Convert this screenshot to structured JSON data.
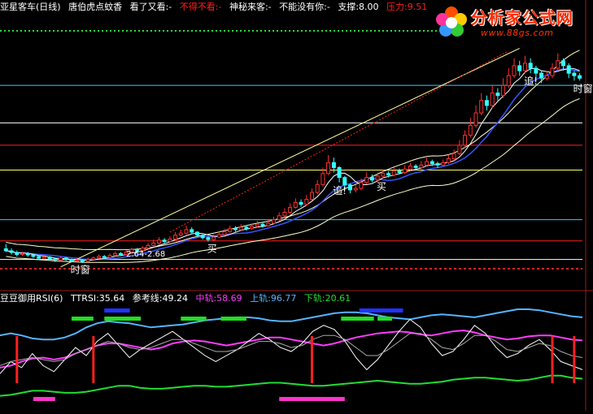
{
  "main_header": {
    "title": "亚星客车(日线)",
    "indicator": "唐伯虎点蚊香",
    "items": [
      {
        "label": "看了又看:-",
        "color": "#ffffff"
      },
      {
        "label": "不得不看:-",
        "color": "#ff2020"
      },
      {
        "label": "神秘来客:-",
        "color": "#ffffff"
      },
      {
        "label": "不能没有你:-",
        "color": "#ffffff"
      },
      {
        "label": "支撑:8.00",
        "color": "#ffffff"
      },
      {
        "label": "压力:9.51",
        "color": "#ff2020"
      }
    ]
  },
  "sub_header": {
    "title": "豆豆御用RSI(6)",
    "items": [
      {
        "label": "TTRSI:35.64",
        "color": "#ffffff"
      },
      {
        "label": "参考线:49.24",
        "color": "#ffffff"
      },
      {
        "label": "中轨:58.69",
        "color": "#ff3cff"
      },
      {
        "label": "上轨:96.77",
        "color": "#55b4ff"
      },
      {
        "label": "下轨:20.61",
        "color": "#22dd33"
      }
    ]
  },
  "logo": {
    "name": "分析家公式网",
    "url": "www.88gs.com"
  },
  "chart_data": [
    {
      "type": "candlestick",
      "panel": "main",
      "description_labels": {
        "annotations": [
          {
            "text": "时窗",
            "x": 14,
            "color": "#ffffff"
          },
          {
            "text": "时窗",
            "x": 112,
            "color": "#ffffff"
          },
          {
            "text": "追!",
            "x": 62,
            "color": "#ffffff"
          },
          {
            "text": "追!",
            "x": 97,
            "color": "#ffffff"
          },
          {
            "text": "买",
            "x": 39,
            "color": "#ffffff"
          },
          {
            "text": "买",
            "x": 70,
            "color": "#ffffff"
          }
        ],
        "value_label": "2.64-2.68"
      },
      "ylim": [
        1.9,
        11.05
      ],
      "bars": [
        [
          2.93,
          2.85,
          3.12,
          2.8
        ],
        [
          2.85,
          2.78,
          2.95,
          2.7
        ],
        [
          2.78,
          2.7,
          2.86,
          2.62
        ],
        [
          2.7,
          2.74,
          2.82,
          2.64
        ],
        [
          2.74,
          2.68,
          2.8,
          2.6
        ],
        [
          2.68,
          2.62,
          2.74,
          2.56
        ],
        [
          2.62,
          2.55,
          2.66,
          2.48
        ],
        [
          2.55,
          2.6,
          2.66,
          2.5
        ],
        [
          2.6,
          2.52,
          2.64,
          2.46
        ],
        [
          2.52,
          2.48,
          2.58,
          2.4
        ],
        [
          2.48,
          2.56,
          2.62,
          2.44
        ],
        [
          2.56,
          2.5,
          2.6,
          2.45
        ],
        [
          2.5,
          2.44,
          2.54,
          2.38
        ],
        [
          2.44,
          2.48,
          2.58,
          2.4
        ],
        [
          2.48,
          2.42,
          2.52,
          2.36
        ],
        [
          2.42,
          2.5,
          2.58,
          2.38
        ],
        [
          2.5,
          2.56,
          2.62,
          2.46
        ],
        [
          2.56,
          2.62,
          2.7,
          2.52
        ],
        [
          2.62,
          2.58,
          2.68,
          2.52
        ],
        [
          2.58,
          2.66,
          2.74,
          2.54
        ],
        [
          2.66,
          2.74,
          2.82,
          2.62
        ],
        [
          2.74,
          2.7,
          2.8,
          2.64
        ],
        [
          2.7,
          2.8,
          2.88,
          2.66
        ],
        [
          2.8,
          2.9,
          2.98,
          2.76
        ],
        [
          2.9,
          2.86,
          2.96,
          2.8
        ],
        [
          2.86,
          2.96,
          3.04,
          2.82
        ],
        [
          2.96,
          3.06,
          3.16,
          2.92
        ],
        [
          3.06,
          3.16,
          3.3,
          3.02
        ],
        [
          3.16,
          3.28,
          3.4,
          3.1
        ],
        [
          3.28,
          3.22,
          3.36,
          3.14
        ],
        [
          3.22,
          3.32,
          3.44,
          3.18
        ],
        [
          3.32,
          3.48,
          3.6,
          3.28
        ],
        [
          3.48,
          3.56,
          3.7,
          3.42
        ],
        [
          3.56,
          3.7,
          3.86,
          3.5
        ],
        [
          3.7,
          3.6,
          3.8,
          3.52
        ],
        [
          3.6,
          3.48,
          3.64,
          3.4
        ],
        [
          3.48,
          3.38,
          3.52,
          3.3
        ],
        [
          3.38,
          3.3,
          3.44,
          3.22
        ],
        [
          3.3,
          3.4,
          3.5,
          3.26
        ],
        [
          3.4,
          3.5,
          3.62,
          3.36
        ],
        [
          3.5,
          3.62,
          3.74,
          3.46
        ],
        [
          3.62,
          3.74,
          3.86,
          3.58
        ],
        [
          3.74,
          3.7,
          3.84,
          3.62
        ],
        [
          3.7,
          3.8,
          3.92,
          3.66
        ],
        [
          3.8,
          3.74,
          3.88,
          3.66
        ],
        [
          3.74,
          3.84,
          3.96,
          3.7
        ],
        [
          3.84,
          3.92,
          4.06,
          3.78
        ],
        [
          3.92,
          3.86,
          4.0,
          3.78
        ],
        [
          3.86,
          3.96,
          4.1,
          3.82
        ],
        [
          3.96,
          4.1,
          4.22,
          3.9
        ],
        [
          4.1,
          4.26,
          4.4,
          4.04
        ],
        [
          4.26,
          4.4,
          4.56,
          4.2
        ],
        [
          4.4,
          4.6,
          4.76,
          4.34
        ],
        [
          4.6,
          4.8,
          4.96,
          4.54
        ],
        [
          4.8,
          4.72,
          4.92,
          4.62
        ],
        [
          4.72,
          4.92,
          5.1,
          4.66
        ],
        [
          4.92,
          5.2,
          5.36,
          4.86
        ],
        [
          5.2,
          5.52,
          5.7,
          5.12
        ],
        [
          5.52,
          5.96,
          6.2,
          5.44
        ],
        [
          5.96,
          6.4,
          6.7,
          5.9
        ],
        [
          6.4,
          6.2,
          6.6,
          6.0
        ],
        [
          6.2,
          5.8,
          6.26,
          5.6
        ],
        [
          5.8,
          5.5,
          5.86,
          5.3
        ],
        [
          5.5,
          5.3,
          5.56,
          5.16
        ],
        [
          5.3,
          5.36,
          5.5,
          5.2
        ],
        [
          5.36,
          5.6,
          5.76,
          5.28
        ],
        [
          5.6,
          5.8,
          6.0,
          5.52
        ],
        [
          5.8,
          5.7,
          5.92,
          5.6
        ],
        [
          5.7,
          5.86,
          6.0,
          5.6
        ],
        [
          5.86,
          5.96,
          6.1,
          5.76
        ],
        [
          5.96,
          5.9,
          6.06,
          5.8
        ],
        [
          5.9,
          6.06,
          6.2,
          5.84
        ],
        [
          6.06,
          6.0,
          6.16,
          5.92
        ],
        [
          6.0,
          6.14,
          6.3,
          5.94
        ],
        [
          6.14,
          6.26,
          6.4,
          6.06
        ],
        [
          6.26,
          6.2,
          6.34,
          6.1
        ],
        [
          6.2,
          6.3,
          6.46,
          6.14
        ],
        [
          6.3,
          6.44,
          6.6,
          6.24
        ],
        [
          6.44,
          6.36,
          6.52,
          6.26
        ],
        [
          6.36,
          6.3,
          6.44,
          6.18
        ],
        [
          6.3,
          6.4,
          6.52,
          6.24
        ],
        [
          6.4,
          6.56,
          6.72,
          6.34
        ],
        [
          6.56,
          6.76,
          6.92,
          6.48
        ],
        [
          6.76,
          7.1,
          7.3,
          6.7
        ],
        [
          7.1,
          7.5,
          7.7,
          7.0
        ],
        [
          7.5,
          7.9,
          8.2,
          7.4
        ],
        [
          7.9,
          8.4,
          8.7,
          7.8
        ],
        [
          8.4,
          8.9,
          9.2,
          8.3
        ],
        [
          8.9,
          8.7,
          9.1,
          8.5
        ],
        [
          8.7,
          9.2,
          9.5,
          8.6
        ],
        [
          9.2,
          9.1,
          9.4,
          8.9
        ],
        [
          9.1,
          9.5,
          9.8,
          9.0
        ],
        [
          9.5,
          9.9,
          10.2,
          9.4
        ],
        [
          9.9,
          10.3,
          10.6,
          9.8
        ],
        [
          10.3,
          10.1,
          10.5,
          9.9
        ],
        [
          10.1,
          10.4,
          10.7,
          10.0
        ],
        [
          10.4,
          10.2,
          10.6,
          10.0
        ],
        [
          10.2,
          10.0,
          10.3,
          9.8
        ],
        [
          10.0,
          9.8,
          10.1,
          9.6
        ],
        [
          9.8,
          9.9,
          10.1,
          9.7
        ],
        [
          9.9,
          10.2,
          10.4,
          9.8
        ],
        [
          10.2,
          10.5,
          10.8,
          10.1
        ],
        [
          10.5,
          10.3,
          10.6,
          10.1
        ],
        [
          10.3,
          10.0,
          10.4,
          9.8
        ],
        [
          10.0,
          9.9,
          10.1,
          9.7
        ],
        [
          9.9,
          9.8,
          10.0,
          9.7
        ]
      ],
      "hlines": [
        {
          "y": 9.51,
          "color": "#33ccff"
        },
        {
          "y": 8.0,
          "color": "#ffffff"
        },
        {
          "y": 7.1,
          "color": "#ff2020"
        },
        {
          "y": 6.1,
          "color": "#ffff66"
        },
        {
          "y": 4.1,
          "color": "#33ccff"
        },
        {
          "y": 3.25,
          "color": "#ff2020"
        },
        {
          "y": 2.5,
          "color": "#ffffff"
        }
      ]
    },
    {
      "type": "line",
      "panel": "sub",
      "title": "豆豆御用RSI(6)",
      "ylim": [
        0,
        100
      ],
      "series": [
        {
          "name": "上轨",
          "color": "#55b4ff",
          "values": [
            70,
            72,
            70,
            67,
            66,
            66,
            68,
            72,
            78,
            82,
            84,
            83,
            82,
            80,
            78,
            79,
            80,
            81,
            83,
            85,
            86,
            87,
            88,
            88,
            87,
            85,
            84,
            84,
            86,
            88,
            90,
            92,
            93,
            93,
            92,
            90,
            88,
            87,
            86,
            88,
            90,
            91,
            90,
            89,
            88,
            90,
            92,
            94,
            96,
            96,
            95,
            93,
            91,
            89,
            88
          ]
        },
        {
          "name": "中轨",
          "color": "#ff3cff",
          "values": [
            38,
            40,
            44,
            47,
            48,
            46,
            48,
            52,
            56,
            60,
            62,
            62,
            60,
            58,
            56,
            58,
            62,
            64,
            65,
            64,
            62,
            60,
            62,
            64,
            66,
            68,
            68,
            66,
            64,
            62,
            60,
            62,
            65,
            68,
            70,
            72,
            73,
            74,
            73,
            71,
            70,
            72,
            74,
            75,
            73,
            70,
            68,
            66,
            67,
            69,
            70,
            70,
            68,
            66,
            65
          ]
        },
        {
          "name": "下轨",
          "color": "#22dd33",
          "values": [
            10,
            11,
            13,
            15,
            15,
            14,
            13,
            13,
            14,
            16,
            18,
            20,
            20,
            18,
            17,
            17,
            18,
            19,
            20,
            20,
            19,
            19,
            20,
            21,
            22,
            23,
            23,
            22,
            21,
            20,
            20,
            21,
            22,
            23,
            24,
            25,
            24,
            23,
            22,
            22,
            23,
            24,
            26,
            27,
            28,
            28,
            27,
            26,
            25,
            26,
            28,
            30,
            30,
            28,
            27
          ]
        },
        {
          "name": "TTRSI",
          "color": "#ffffff",
          "values": [
            32,
            44,
            38,
            52,
            40,
            34,
            46,
            58,
            50,
            64,
            72,
            60,
            48,
            56,
            62,
            68,
            74,
            66,
            58,
            50,
            44,
            50,
            56,
            64,
            72,
            66,
            58,
            54,
            62,
            74,
            80,
            76,
            64,
            48,
            36,
            46,
            60,
            74,
            86,
            78,
            62,
            50,
            54,
            66,
            80,
            72,
            58,
            48,
            52,
            60,
            66,
            56,
            44,
            40,
            36
          ]
        },
        {
          "name": "参考线",
          "color": "#aaaaaa",
          "values": [
            40,
            44,
            46,
            48,
            46,
            44,
            46,
            52,
            56,
            60,
            64,
            62,
            58,
            56,
            58,
            62,
            66,
            66,
            62,
            58,
            54,
            54,
            56,
            60,
            64,
            64,
            62,
            58,
            60,
            66,
            70,
            70,
            66,
            58,
            50,
            50,
            56,
            64,
            72,
            72,
            66,
            58,
            56,
            62,
            70,
            70,
            64,
            56,
            54,
            58,
            62,
            60,
            54,
            50,
            48
          ]
        }
      ],
      "events": {
        "red_spikes": [
          1,
          8,
          28,
          50,
          52,
          65
        ],
        "blue_blocks": [
          [
            27,
            34
          ],
          [
            97,
            109
          ]
        ],
        "green_blocks": [
          [
            18,
            24
          ],
          [
            27,
            37
          ],
          [
            48,
            55
          ],
          [
            59,
            66
          ],
          [
            92,
            101
          ],
          [
            102,
            106
          ]
        ],
        "magenta_blocks": [
          [
            1,
            2
          ],
          [
            10,
            13
          ]
        ]
      }
    }
  ]
}
